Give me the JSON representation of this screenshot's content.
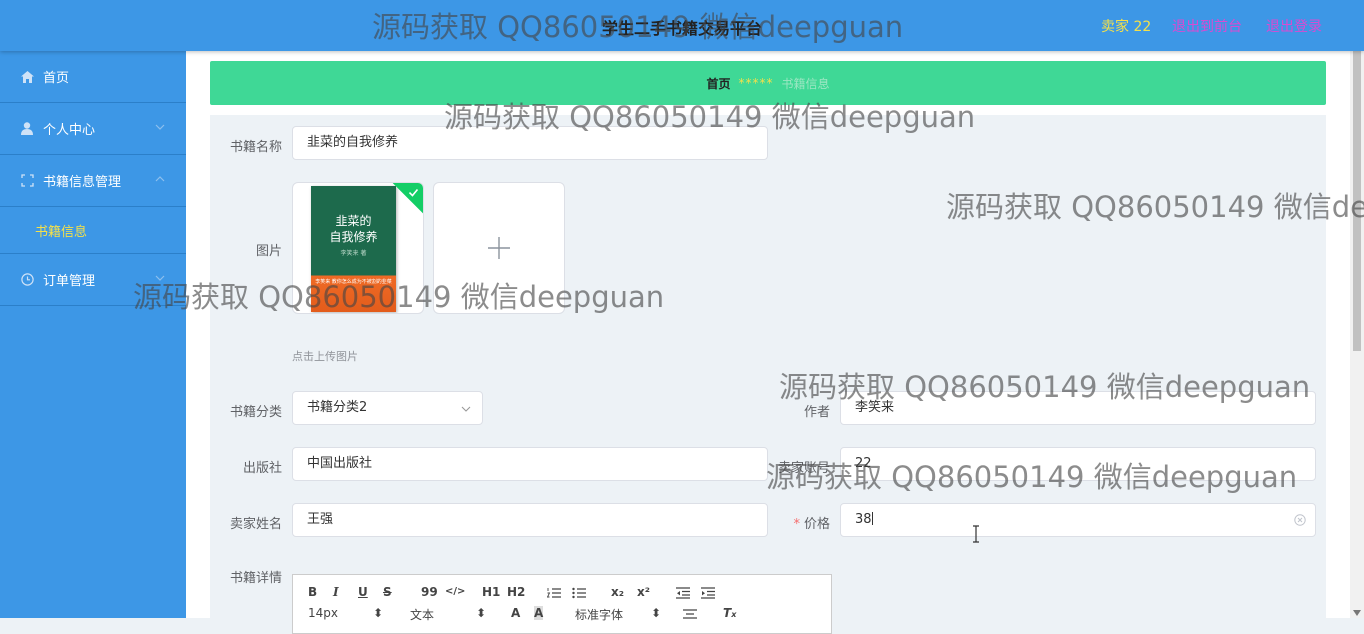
{
  "header": {
    "title": "学生二手书籍交易平台",
    "seller_label": "卖家 22",
    "back_label": "退出到前台",
    "logout_label": "退出登录"
  },
  "sidebar": {
    "items": [
      {
        "label": "首页",
        "icon": "home-icon"
      },
      {
        "label": "个人中心",
        "icon": "user-icon"
      },
      {
        "label": "书籍信息管理",
        "icon": "grid-icon"
      },
      {
        "label": "订单管理",
        "icon": "clock-icon"
      }
    ],
    "submenu": [
      {
        "label": "书籍信息"
      }
    ]
  },
  "breadcrumb": {
    "home": "首页",
    "separator": "*****",
    "current": "书籍信息"
  },
  "form": {
    "name": {
      "label": "书籍名称",
      "value": "韭菜的自我修养"
    },
    "image": {
      "label": "图片",
      "hint": "点击上传图片",
      "cover_title_1": "韭菜的",
      "cover_title_2": "自我修养",
      "cover_author": "李笑来 著",
      "cover_banner": "李笑来 教你怎么成为不被割的韭菜"
    },
    "category": {
      "label": "书籍分类",
      "value": "书籍分类2"
    },
    "author": {
      "label": "作者",
      "value": "李笑来"
    },
    "publisher": {
      "label": "出版社",
      "value": "中国出版社"
    },
    "seller_account": {
      "label": "卖家账号",
      "value": "22"
    },
    "seller_name": {
      "label": "卖家姓名",
      "value": "王强"
    },
    "price": {
      "label": "价格",
      "required_mark": "*",
      "value": "38"
    },
    "detail": {
      "label": "书籍详情"
    }
  },
  "editor_toolbar": {
    "bold": "B",
    "italic": "I",
    "underline": "U",
    "strike": "S",
    "quote": "99",
    "code": "</>",
    "h1": "H1",
    "h2": "H2",
    "sub": "x₂",
    "sup": "x²",
    "font_size": "14px",
    "text_type": "文本",
    "font_family": "标准字体"
  },
  "watermark": "源码获取 QQ86050149 微信deepguan",
  "colors": {
    "header": "#3d97e6",
    "breadcrumb": "#3fd896",
    "accent_yellow": "#f4e04a",
    "accent_magenta": "#d94bd2",
    "panel": "#edf2f6"
  }
}
